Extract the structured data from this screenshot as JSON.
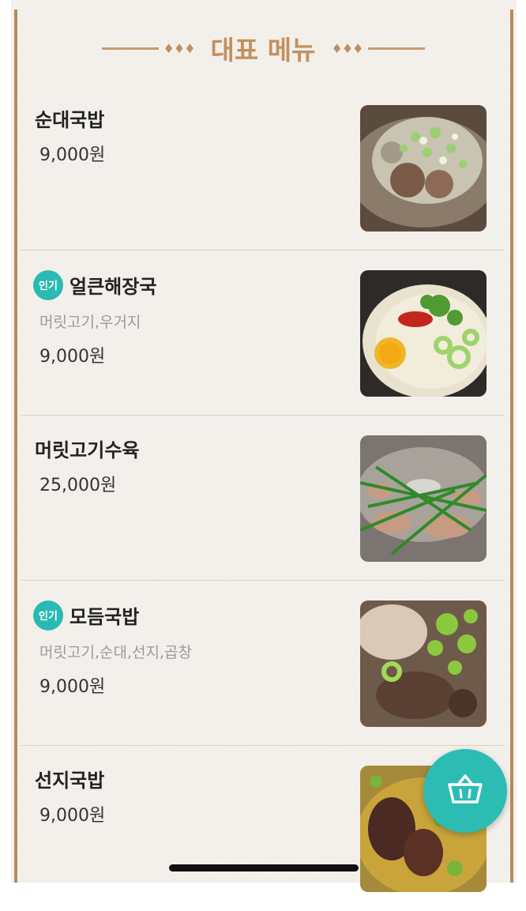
{
  "header": {
    "title": "대표 메뉴",
    "left_deco": "♦♦♦",
    "right_deco": "♦♦♦"
  },
  "menu": [
    {
      "name": "순대국밥",
      "price": "9,000원",
      "badge": "",
      "description": "",
      "image": "sundae-gukbap-photo"
    },
    {
      "name": "얼큰해장국",
      "price": "9,000원",
      "badge": "인기",
      "description": "머릿고기,우거지",
      "image": "haejangguk-photo"
    },
    {
      "name": "머릿고기수육",
      "price": "25,000원",
      "badge": "",
      "description": "",
      "image": "suyuk-photo"
    },
    {
      "name": "모듬국밥",
      "price": "9,000원",
      "badge": "인기",
      "description": "머릿고기,순대,선지,곱창",
      "image": "modum-gukbap-photo"
    },
    {
      "name": "선지국밥",
      "price": "9,000원",
      "badge": "",
      "description": "",
      "image": "seonji-gukbap-photo"
    }
  ],
  "cart": {
    "icon": "basket-icon"
  },
  "colors": {
    "accent": "#2bbab3",
    "brand_brown": "#c4905e",
    "divider": "#e8cdb6"
  }
}
